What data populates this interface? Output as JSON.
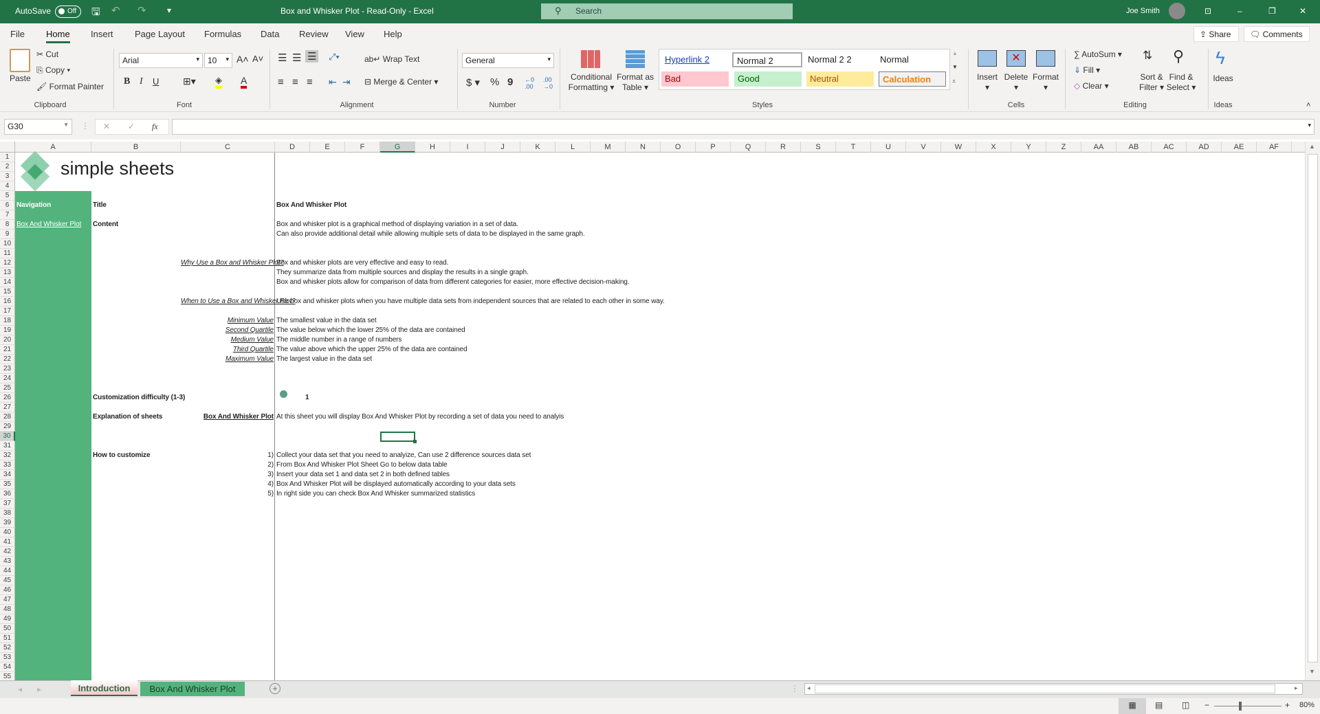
{
  "titlebar": {
    "autosave": "AutoSave",
    "autosave_state": "Off",
    "title": "Box and Whisker Plot  -  Read-Only  -  Excel",
    "search": "Search",
    "user": "Joe Smith"
  },
  "ribbon_tabs": [
    "File",
    "Home",
    "Insert",
    "Page Layout",
    "Formulas",
    "Data",
    "Review",
    "View",
    "Help"
  ],
  "share": "Share",
  "comments": "Comments",
  "clipboard": {
    "paste": "Paste",
    "cut": "Cut",
    "copy": "Copy",
    "format_painter": "Format Painter",
    "label": "Clipboard"
  },
  "font": {
    "name": "Arial",
    "size": "10",
    "bold": "B",
    "italic": "I",
    "underline": "U",
    "label": "Font"
  },
  "alignment": {
    "wrap": "Wrap Text",
    "merge": "Merge & Center",
    "label": "Alignment"
  },
  "number": {
    "format": "General",
    "currency": "$",
    "percent": "%",
    "comma": "9",
    "label": "Number"
  },
  "styles": {
    "conditional": "Conditional",
    "conditional2": "Formatting",
    "format_table": "Format as",
    "format_table2": "Table",
    "gallery": [
      "Hyperlink 2",
      "Normal 2",
      "Normal 2 2",
      "Normal",
      "Bad",
      "Good",
      "Neutral",
      "Calculation"
    ],
    "label": "Styles"
  },
  "cells_group": {
    "insert": "Insert",
    "delete": "Delete",
    "format": "Format",
    "label": "Cells"
  },
  "editing": {
    "autosum": "AutoSum",
    "fill": "Fill",
    "clear": "Clear",
    "sort": "Sort &",
    "sort2": "Filter",
    "find": "Find &",
    "find2": "Select",
    "label": "Editing"
  },
  "ideas": {
    "button": "Ideas",
    "label": "Ideas"
  },
  "formula_bar": {
    "name_box": "G30",
    "formula": ""
  },
  "columns": [
    "A",
    "B",
    "C",
    "D",
    "E",
    "F",
    "G",
    "H",
    "I",
    "J",
    "K",
    "L",
    "M",
    "N",
    "O",
    "P",
    "Q",
    "R",
    "S",
    "T",
    "U",
    "V",
    "W",
    "X",
    "Y",
    "Z",
    "AA",
    "AB",
    "AC",
    "AD",
    "AE",
    "AF"
  ],
  "row_count": 55,
  "selected_cell": "G30",
  "logo_text": "simple sheets",
  "cells": [
    {
      "r": 6,
      "c": "A",
      "text": "Navigation",
      "style": "navhead"
    },
    {
      "r": 8,
      "c": "A",
      "text": "Box And Whisker Plot",
      "style": "navlink"
    },
    {
      "r": 6,
      "c": "B",
      "text": "Title",
      "style": "bold"
    },
    {
      "r": 6,
      "c": "D",
      "text": "Box And Whisker Plot",
      "style": "bold"
    },
    {
      "r": 8,
      "c": "B",
      "text": "Content",
      "style": "bold"
    },
    {
      "r": 8,
      "c": "D",
      "text": "Box and whisker plot is a graphical method of displaying variation in a set of data."
    },
    {
      "r": 9,
      "c": "D",
      "text": "Can also provide additional detail while allowing multiple sets of data to be displayed in the same graph."
    },
    {
      "r": 12,
      "c": "C",
      "text": "Why Use a Box and Whisker Plot?",
      "style": "linkr"
    },
    {
      "r": 12,
      "c": "D",
      "text": "Box and whisker plots are very effective and easy to read."
    },
    {
      "r": 13,
      "c": "D",
      "text": "They summarize data from multiple sources and display the results in a single graph."
    },
    {
      "r": 14,
      "c": "D",
      "text": "Box and whisker plots allow for comparison of data from different categories for easier, more effective decision-making."
    },
    {
      "r": 16,
      "c": "C",
      "text": "When to Use a Box and Whisker Plot?",
      "style": "linkr"
    },
    {
      "r": 16,
      "c": "D",
      "text": "Use box and whisker plots when you have multiple data sets from independent sources that are related to each other in some way."
    },
    {
      "r": 18,
      "c": "C",
      "text": "Minimum Value",
      "style": "linkr"
    },
    {
      "r": 18,
      "c": "D",
      "text": "The smallest value in the data set"
    },
    {
      "r": 19,
      "c": "C",
      "text": "Second Quartile",
      "style": "linkr"
    },
    {
      "r": 19,
      "c": "D",
      "text": "The value below which the lower 25% of the data are contained"
    },
    {
      "r": 20,
      "c": "C",
      "text": "Medium Value",
      "style": "linkr"
    },
    {
      "r": 20,
      "c": "D",
      "text": "The middle number in a range of numbers"
    },
    {
      "r": 21,
      "c": "C",
      "text": "Third Quartile",
      "style": "linkr"
    },
    {
      "r": 21,
      "c": "D",
      "text": "The value above which the upper 25% of the data are contained"
    },
    {
      "r": 22,
      "c": "C",
      "text": "Maximum Value",
      "style": "linkr"
    },
    {
      "r": 22,
      "c": "D",
      "text": "The largest value in the data set"
    },
    {
      "r": 26,
      "c": "B",
      "text": "Customization difficulty (1-3)",
      "style": "bold"
    },
    {
      "r": 26,
      "c": "D",
      "text": "1",
      "style": "difficulty"
    },
    {
      "r": 28,
      "c": "B",
      "text": "Explanation of sheets",
      "style": "bold"
    },
    {
      "r": 28,
      "c": "C",
      "text": "Box And Whisker Plot",
      "style": "boldlinkr"
    },
    {
      "r": 28,
      "c": "D",
      "text": "At this sheet you will display Box And Whisker Plot by recording a set of data you need to analyis"
    },
    {
      "r": 32,
      "c": "B",
      "text": "How to customize",
      "style": "bold"
    },
    {
      "r": 32,
      "c": "C",
      "text": "1)",
      "style": "right"
    },
    {
      "r": 32,
      "c": "D",
      "text": "Collect your data set that you need to analyize, Can use 2 difference sources data set"
    },
    {
      "r": 33,
      "c": "C",
      "text": "2)",
      "style": "right"
    },
    {
      "r": 33,
      "c": "D",
      "text": "From Box And Whisker Plot Sheet Go to below data table"
    },
    {
      "r": 34,
      "c": "C",
      "text": "3)",
      "style": "right"
    },
    {
      "r": 34,
      "c": "D",
      "text": "Insert your data set 1 and data set 2 in both defined tables"
    },
    {
      "r": 35,
      "c": "C",
      "text": "4)",
      "style": "right"
    },
    {
      "r": 35,
      "c": "D",
      "text": "Box And Whisker Plot will be displayed automatically according to your data sets"
    },
    {
      "r": 36,
      "c": "C",
      "text": "5)",
      "style": "right"
    },
    {
      "r": 36,
      "c": "D",
      "text": "In right side you can check Box And Whisker summarized statistics"
    }
  ],
  "sheet_tabs": [
    {
      "label": "Introduction",
      "active": true
    },
    {
      "label": "Box And Whisker Plot",
      "active": false
    }
  ],
  "zoom": "80%",
  "colors": {
    "excel_green": "#217346",
    "nav_green": "#52b47c",
    "difficulty_dot": "#5a9e82"
  }
}
